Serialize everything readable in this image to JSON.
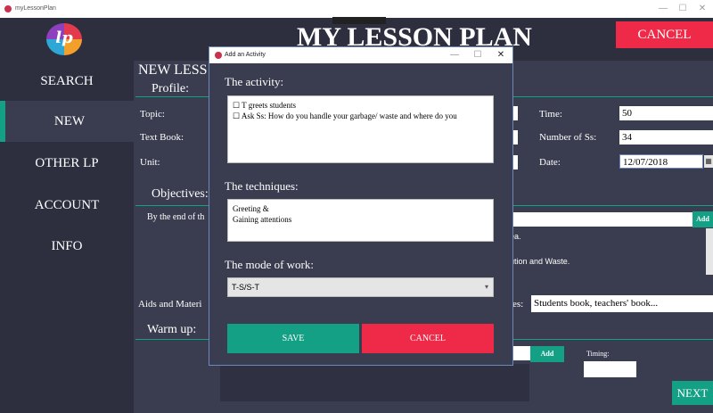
{
  "window": {
    "title": "myLessonPlan",
    "minimize": "—",
    "maximize": "☐",
    "close": "✕"
  },
  "header": {
    "logo_text": "lp",
    "title": "MY LESSON PLAN",
    "cancel_label": "CANCEL"
  },
  "sidebar": {
    "items": [
      {
        "label": "SEARCH"
      },
      {
        "label": "NEW"
      },
      {
        "label": "OTHER LP"
      },
      {
        "label": "ACCOUNT"
      },
      {
        "label": "INFO"
      }
    ]
  },
  "main": {
    "heading": "NEW LESS",
    "profile_section": "Profile:",
    "topic_label": "Topic:",
    "textbook_label": "Text Book:",
    "unit_label": "Unit:",
    "time_label": "Time:",
    "time_value": "50",
    "number_label": "Number of Ss:",
    "number_value": "34",
    "date_label": "Date:",
    "date_value": "12/07/2018",
    "objectives_section": "Objectives:",
    "objectives_intro": "By the end of th",
    "add_label": "Add",
    "objective_line1": "lea.",
    "objective_line2": "lution and Waste.",
    "aids_label": "Aids and Materi",
    "aids_suffix": "es:",
    "aids_value": "Students book, teachers' book...",
    "warmup_section": "Warm up:",
    "add2_label": "Add",
    "timing_label": "Timing:",
    "next_label": "NEXT"
  },
  "dialog": {
    "title": "Add an Activity",
    "minimize": "—",
    "maximize": "☐",
    "close": "✕",
    "activity_label": "The activity:",
    "activity_line1": "☐ T greets students",
    "activity_line2": "☐ Ask Ss: How do you handle your garbage/ waste and where do you",
    "techniques_label": "The techniques:",
    "technique_line1": "Greeting &",
    "technique_line2": "Gaining attentions",
    "mode_label": "The mode of work:",
    "mode_value": "T-S/S-T",
    "save_label": "SAVE",
    "cancel_label": "CANCEL"
  },
  "colors": {
    "background": "#2d2f3f",
    "panel": "#3a3d50",
    "accent_green": "#14a085",
    "accent_red": "#ef2a48"
  },
  "icons": {
    "app": "app-logo-icon",
    "calendar": "calendar-icon",
    "dropdown": "chevron-down-icon"
  }
}
